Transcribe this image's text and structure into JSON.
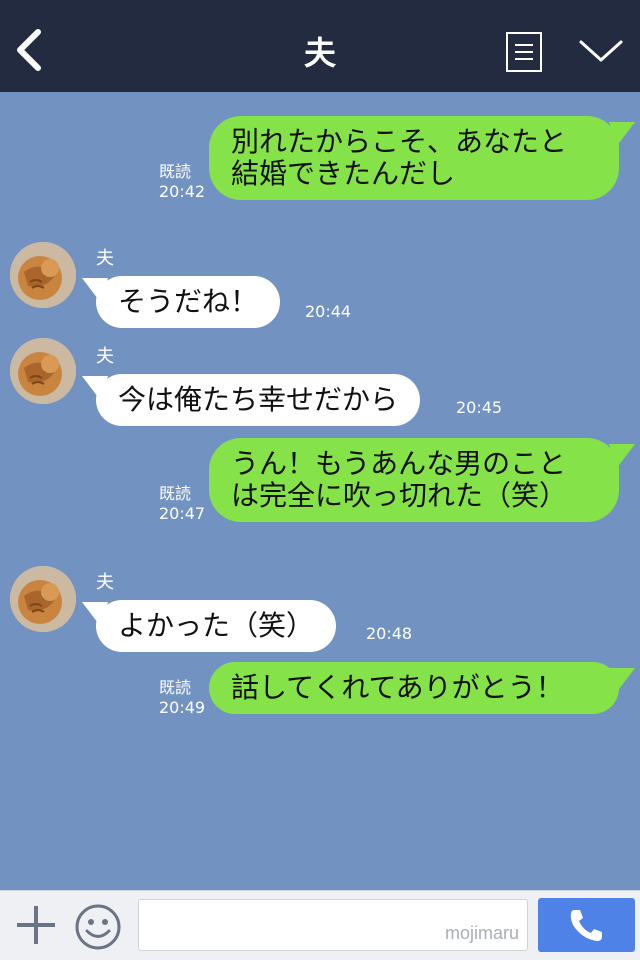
{
  "header": {
    "title": "夫",
    "back_icon": "chevron-left-icon",
    "menu_icon": "document-menu-icon",
    "collapse_icon": "chevron-down-icon",
    "background": "#232b40"
  },
  "chat": {
    "background": "#7293c2",
    "sent_color": "#85e249",
    "received_color": "#ffffff",
    "messages": [
      {
        "from": "me",
        "lines": [
          "別れたからこそ、あなたと",
          "結婚できたんだし"
        ],
        "read": "既読",
        "time": "20:42"
      },
      {
        "from": "夫",
        "name": "夫",
        "lines": [
          "そうだね！"
        ],
        "time": "20:44"
      },
      {
        "from": "夫",
        "name": "夫",
        "lines": [
          "今は俺たち幸せだから"
        ],
        "time": "20:45"
      },
      {
        "from": "me",
        "lines": [
          "うん！もうあんな男のこと",
          "は完全に吹っ切れた（笑）"
        ],
        "read": "既読",
        "time": "20:47"
      },
      {
        "from": "夫",
        "name": "夫",
        "lines": [
          "よかった（笑）"
        ],
        "time": "20:48"
      },
      {
        "from": "me",
        "lines": [
          "話してくれてありがとう！"
        ],
        "read": "既読",
        "time": "20:49"
      }
    ]
  },
  "bottom_bar": {
    "plus_icon": "plus-icon",
    "emoji_icon": "smiley-icon",
    "input_value": "",
    "watermark": "mojimaru",
    "call_icon": "phone-icon",
    "call_color": "#4e82e6"
  }
}
